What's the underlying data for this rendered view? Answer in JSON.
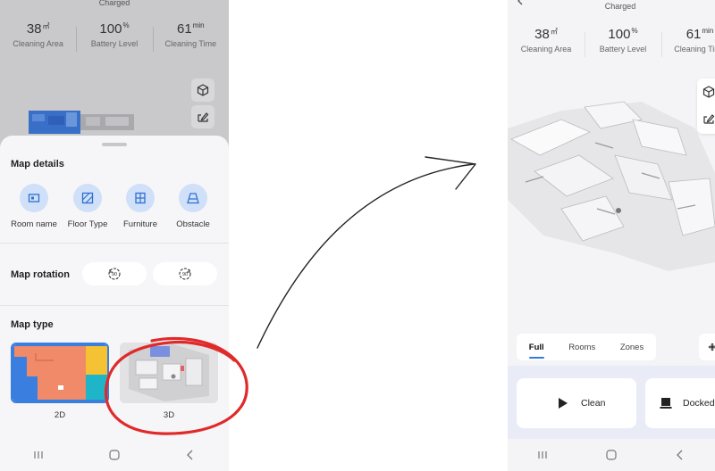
{
  "left": {
    "status": "Charged",
    "stats": [
      {
        "value": "38",
        "unit": "㎡",
        "label": "Cleaning Area"
      },
      {
        "value": "100",
        "unit": "%",
        "label": "Battery Level"
      },
      {
        "value": "61",
        "unit": "min",
        "label": "Cleaning Time"
      }
    ],
    "sheet": {
      "map_details_title": "Map details",
      "details": [
        {
          "label": "Room name",
          "icon": "room-name-icon"
        },
        {
          "label": "Floor Type",
          "icon": "floor-type-icon"
        },
        {
          "label": "Furniture",
          "icon": "furniture-icon"
        },
        {
          "label": "Obstacle",
          "icon": "obstacle-icon"
        }
      ],
      "rotation_title": "Map rotation",
      "rotation_buttons": [
        {
          "icon": "rotate-left-icon",
          "text": "90"
        },
        {
          "icon": "rotate-right-icon",
          "text": "90"
        }
      ],
      "map_type_title": "Map type",
      "map_types": [
        {
          "label": "2D",
          "selected": true
        },
        {
          "label": "3D",
          "selected": false,
          "annotated": true
        }
      ]
    }
  },
  "right": {
    "status": "Charged",
    "stats": [
      {
        "value": "38",
        "unit": "㎡",
        "label": "Cleaning Area"
      },
      {
        "value": "100",
        "unit": "%",
        "label": "Battery Level"
      },
      {
        "value": "61",
        "unit": "min",
        "label": "Cleaning Time"
      }
    ],
    "tabs": [
      {
        "label": "Full",
        "active": true
      },
      {
        "label": "Rooms",
        "active": false
      },
      {
        "label": "Zones",
        "active": false
      }
    ],
    "actions": [
      {
        "label": "Clean",
        "icon": "play-icon"
      },
      {
        "label": "Docked",
        "icon": "dock-icon"
      }
    ]
  },
  "colors": {
    "accent": "#2f7be0",
    "annotation": "#e02a2a",
    "icon_bg": "#cfe0f8",
    "map_orange": "#f08a68",
    "map_yellow": "#f5c233",
    "map_teal": "#1fb5c8",
    "map_blue": "#3a7fe0"
  },
  "navbar": [
    "recents-icon",
    "home-icon",
    "back-icon"
  ]
}
